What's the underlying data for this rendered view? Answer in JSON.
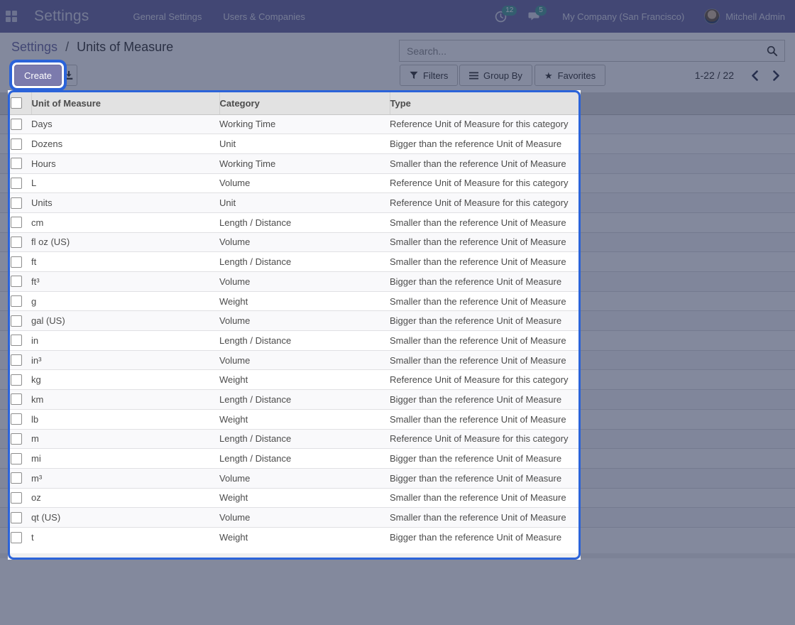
{
  "navbar": {
    "app_title": "Settings",
    "menu_items": [
      {
        "label": "General Settings"
      },
      {
        "label": "Users & Companies"
      }
    ],
    "activity_count": "12",
    "message_count": "5",
    "company": "My Company (San Francisco)",
    "user": "Mitchell Admin"
  },
  "breadcrumb": {
    "parent": "Settings",
    "separator": "/",
    "current": "Units of Measure"
  },
  "toolbar": {
    "create_label": "Create"
  },
  "search": {
    "placeholder": "Search..."
  },
  "filter_bar": {
    "filters_label": "Filters",
    "group_by_label": "Group By",
    "favorites_label": "Favorites",
    "star_glyph": "★"
  },
  "pagination": {
    "range": "1-22 / 22"
  },
  "table": {
    "columns": [
      "Unit of Measure",
      "Category",
      "Type"
    ],
    "rows": [
      {
        "name": "Days",
        "category": "Working Time",
        "type": "Reference Unit of Measure for this category"
      },
      {
        "name": "Dozens",
        "category": "Unit",
        "type": "Bigger than the reference Unit of Measure"
      },
      {
        "name": "Hours",
        "category": "Working Time",
        "type": "Smaller than the reference Unit of Measure"
      },
      {
        "name": "L",
        "category": "Volume",
        "type": "Reference Unit of Measure for this category"
      },
      {
        "name": "Units",
        "category": "Unit",
        "type": "Reference Unit of Measure for this category"
      },
      {
        "name": "cm",
        "category": "Length / Distance",
        "type": "Smaller than the reference Unit of Measure"
      },
      {
        "name": "fl oz (US)",
        "category": "Volume",
        "type": "Smaller than the reference Unit of Measure"
      },
      {
        "name": "ft",
        "category": "Length / Distance",
        "type": "Smaller than the reference Unit of Measure"
      },
      {
        "name": "ft³",
        "category": "Volume",
        "type": "Bigger than the reference Unit of Measure"
      },
      {
        "name": "g",
        "category": "Weight",
        "type": "Smaller than the reference Unit of Measure"
      },
      {
        "name": "gal (US)",
        "category": "Volume",
        "type": "Bigger than the reference Unit of Measure"
      },
      {
        "name": "in",
        "category": "Length / Distance",
        "type": "Smaller than the reference Unit of Measure"
      },
      {
        "name": "in³",
        "category": "Volume",
        "type": "Smaller than the reference Unit of Measure"
      },
      {
        "name": "kg",
        "category": "Weight",
        "type": "Reference Unit of Measure for this category"
      },
      {
        "name": "km",
        "category": "Length / Distance",
        "type": "Bigger than the reference Unit of Measure"
      },
      {
        "name": "lb",
        "category": "Weight",
        "type": "Smaller than the reference Unit of Measure"
      },
      {
        "name": "m",
        "category": "Length / Distance",
        "type": "Reference Unit of Measure for this category"
      },
      {
        "name": "mi",
        "category": "Length / Distance",
        "type": "Bigger than the reference Unit of Measure"
      },
      {
        "name": "m³",
        "category": "Volume",
        "type": "Bigger than the reference Unit of Measure"
      },
      {
        "name": "oz",
        "category": "Weight",
        "type": "Smaller than the reference Unit of Measure"
      },
      {
        "name": "qt (US)",
        "category": "Volume",
        "type": "Smaller than the reference Unit of Measure"
      },
      {
        "name": "t",
        "category": "Weight",
        "type": "Bigger than the reference Unit of Measure"
      }
    ]
  },
  "colors": {
    "navbar_bg": "#7C7BAD",
    "primary_button": "#7C7BAD",
    "highlight_blue": "#2b63d9",
    "badge_teal": "#5fa8a3",
    "header_bg": "#e2e2e2"
  }
}
